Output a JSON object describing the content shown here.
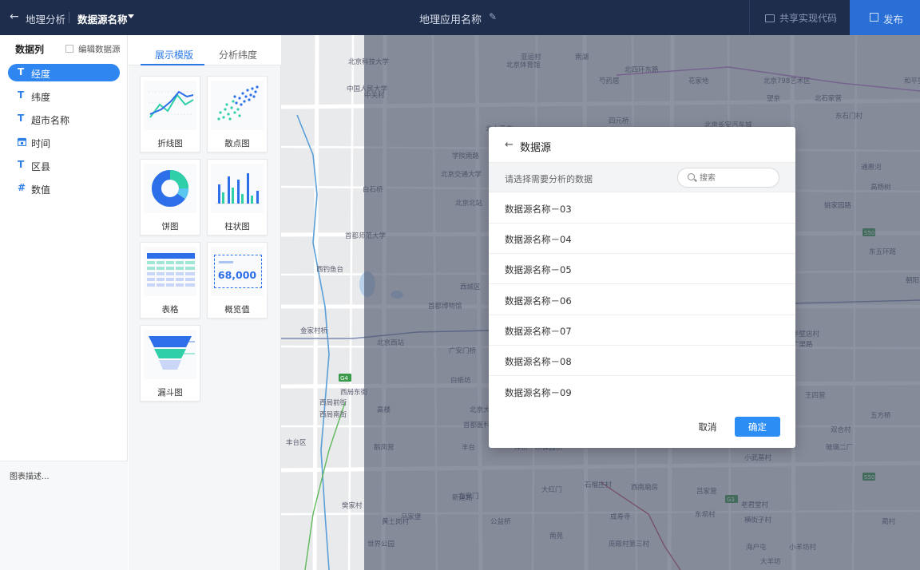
{
  "header": {
    "back_icon": "arrow-left-icon",
    "app_title": "地理分析",
    "datasource_name": "数据源名称",
    "center_title": "地理应用名称",
    "share_label": "共享实现代码",
    "publish_label": "发布"
  },
  "sidebar": {
    "title": "数据列",
    "edit_label": "编辑数据源",
    "fields": [
      {
        "type_icon": "T",
        "label": "经度"
      },
      {
        "type_icon": "T",
        "label": "纬度"
      },
      {
        "type_icon": "T",
        "label": "超市名称"
      },
      {
        "type_icon": "calendar-icon",
        "label": "时间"
      },
      {
        "type_icon": "T",
        "label": "区县"
      },
      {
        "type_icon": "#",
        "label": "数值"
      }
    ],
    "description_placeholder": "图表描述..."
  },
  "templates": {
    "tabs": [
      "展示模版",
      "分析纬度"
    ],
    "items": [
      {
        "label": "折线图",
        "icon": "line-chart-icon"
      },
      {
        "label": "散点图",
        "icon": "scatter-chart-icon"
      },
      {
        "label": "饼图",
        "icon": "pie-chart-icon"
      },
      {
        "label": "柱状图",
        "icon": "bar-chart-icon"
      },
      {
        "label": "表格",
        "icon": "table-icon"
      },
      {
        "label": "概览值",
        "icon": "kpi-value-icon",
        "preview_value": "68,000"
      },
      {
        "label": "漏斗图",
        "icon": "funnel-chart-icon"
      }
    ]
  },
  "map": {
    "labels": [
      "中国人民大学",
      "北京科技大学",
      "中关村",
      "北太平庄",
      "学院南路",
      "北京交通大学",
      "北京北站",
      "白石桥",
      "首都师范大学",
      "西钓鱼台",
      "西城区",
      "首都博物馆",
      "金家村桥",
      "北京西站",
      "广安门桥",
      "白纸坊",
      "西局东街",
      "西局前街",
      "西局南街",
      "丰台区",
      "高楼",
      "北京大观园",
      "首都医科大学",
      "丰台",
      "鹅凤营",
      "洋桥",
      "木樨园桥",
      "大红门",
      "右安门",
      "马家堡",
      "新建路",
      "公益桥",
      "樊家村",
      "黄土岗村",
      "世界公园",
      "南苑",
      "北京798艺术区",
      "芍药居",
      "花家地",
      "高杨树",
      "姚家园路",
      "东五环路",
      "朝阳",
      "半壁店村",
      "广渠路",
      "王四营",
      "双合村",
      "五方桥",
      "玻璃二厂",
      "小武基村",
      "吕家营",
      "老君堂村",
      "东坝村",
      "横街子村",
      "西南磨房",
      "石榴庄村",
      "成寿寺",
      "庞殿村第三村",
      "海户屯",
      "小羊坊村",
      "大羊坊",
      "蔺村",
      "亚运村",
      "北四环东路",
      "南湖",
      "北京体育馆",
      "北京长安汽车城",
      "四元桥",
      "望京",
      "北石家营",
      "和平里",
      "东石门村",
      "通惠河"
    ],
    "highways": [
      "G4",
      "S50",
      "S50",
      "G3"
    ]
  },
  "dialog": {
    "back_icon": "arrow-left-icon",
    "title": "数据源",
    "hint": "请选择需要分析的数据",
    "search_placeholder": "搜索",
    "items": [
      "数据源名称－03",
      "数据源名称－04",
      "数据源名称－05",
      "数据源名称－06",
      "数据源名称－07",
      "数据源名称－08",
      "数据源名称－09"
    ],
    "cancel_label": "取消",
    "ok_label": "确定"
  },
  "colors": {
    "header_bg": "#1f2d4d",
    "publish_bg": "#2a6fd6",
    "accent": "#2f86f0",
    "overlay": "#485068",
    "ok_button": "#2c8ef5"
  }
}
